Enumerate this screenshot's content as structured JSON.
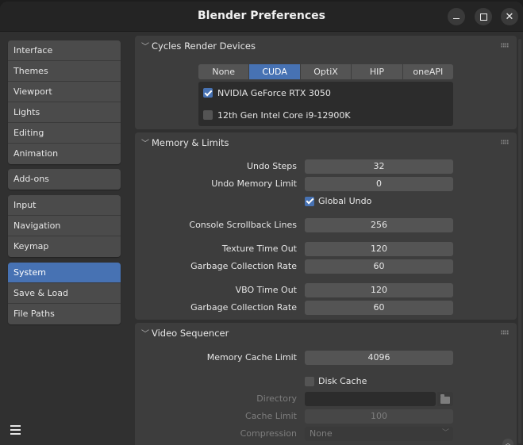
{
  "window": {
    "title": "Blender Preferences",
    "controls": {
      "minimize": "minimize-icon",
      "maximize": "maximize-icon",
      "close": "close-icon"
    }
  },
  "sidebar": {
    "groups": [
      [
        "Interface",
        "Themes",
        "Viewport",
        "Lights",
        "Editing",
        "Animation"
      ],
      [
        "Add-ons"
      ],
      [
        "Input",
        "Navigation",
        "Keymap"
      ],
      [
        "System",
        "Save & Load",
        "File Paths"
      ]
    ],
    "active": "System",
    "menu_icon": "hamburger-icon"
  },
  "cycles": {
    "title": "Cycles Render Devices",
    "options": [
      "None",
      "CUDA",
      "OptiX",
      "HIP",
      "oneAPI"
    ],
    "selected": "CUDA",
    "devices": [
      {
        "name": "NVIDIA GeForce RTX 3050",
        "checked": true
      },
      {
        "name": "12th Gen Intel Core i9-12900K",
        "checked": false
      }
    ]
  },
  "memory": {
    "title": "Memory & Limits",
    "undo_steps_label": "Undo Steps",
    "undo_steps": "32",
    "undo_mem_label": "Undo Memory Limit",
    "undo_mem": "0",
    "global_undo_label": "Global Undo",
    "global_undo": true,
    "console_label": "Console Scrollback Lines",
    "console": "256",
    "tex_timeout_label": "Texture Time Out",
    "tex_timeout": "120",
    "gc_rate_label": "Garbage Collection Rate",
    "gc_rate": "60",
    "vbo_timeout_label": "VBO Time Out",
    "vbo_timeout": "120",
    "gc_rate2_label": "Garbage Collection Rate",
    "gc_rate2": "60"
  },
  "video": {
    "title": "Video Sequencer",
    "mem_cache_label": "Memory Cache Limit",
    "mem_cache": "4096",
    "disk_cache_label": "Disk Cache",
    "disk_cache": false,
    "directory_label": "Directory",
    "directory": "",
    "cache_limit_label": "Cache Limit",
    "cache_limit": "100",
    "compression_label": "Compression",
    "compression": "None"
  }
}
